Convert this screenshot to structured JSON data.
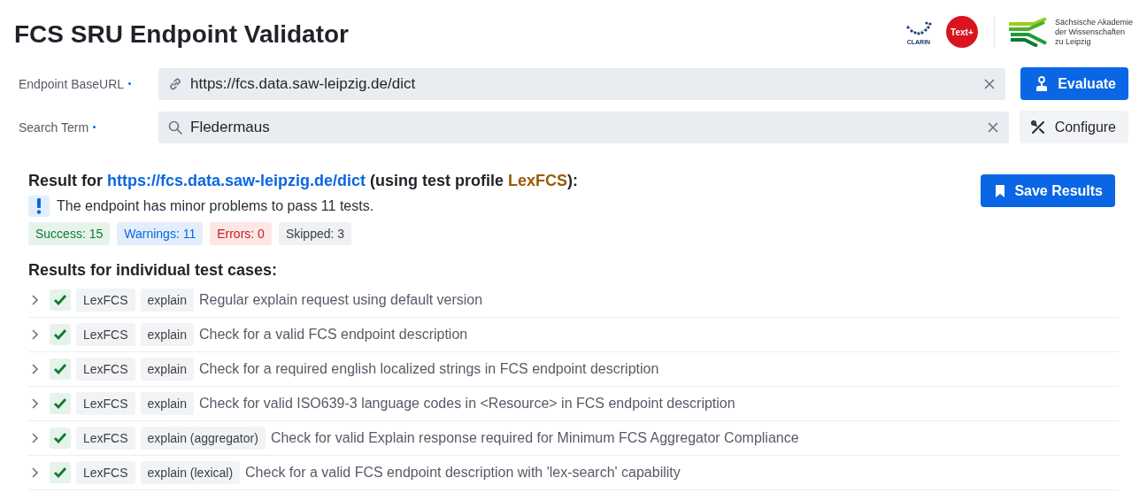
{
  "header": {
    "title": "FCS SRU Endpoint Validator",
    "logos": [
      {
        "kind": "clarin",
        "text": "CLARIN"
      },
      {
        "kind": "textplus",
        "text": "Text+"
      },
      {
        "kind": "saw",
        "lines": [
          "Sächsische Akademie",
          "der Wissenschaften",
          "zu Leipzig"
        ]
      }
    ]
  },
  "form": {
    "fields": [
      {
        "label": "Endpoint BaseURL",
        "required": true,
        "kind": "url",
        "value": "https://fcs.data.saw-leipzig.de/dict",
        "button": {
          "label": "Evaluate",
          "kind": "primary"
        }
      },
      {
        "label": "Search Term",
        "required": true,
        "kind": "search",
        "value": "Fledermaus",
        "button": {
          "label": "Configure",
          "kind": "secondary"
        }
      }
    ]
  },
  "result": {
    "prefix": "Result for",
    "endpoint": "https://fcs.data.saw-leipzig.de/dict",
    "middle": "(using test profile",
    "profile": "LexFCS",
    "suffix": "):",
    "message": "The endpoint has minor problems to pass 11 tests.",
    "save_button": "Save Results",
    "counts": [
      {
        "kind": "success",
        "label": "Success: 15"
      },
      {
        "kind": "warning",
        "label": "Warnings: 11"
      },
      {
        "kind": "error",
        "label": "Errors: 0"
      },
      {
        "kind": "skipped",
        "label": "Skipped: 3"
      }
    ]
  },
  "tests": {
    "heading": "Results for individual test cases:",
    "rows": [
      {
        "kind": "success",
        "expanded": false,
        "profile": "LexFCS",
        "category": "explain",
        "description": "Regular explain request using default version"
      },
      {
        "kind": "success",
        "expanded": false,
        "profile": "LexFCS",
        "category": "explain",
        "description": "Check for a valid FCS endpoint description"
      },
      {
        "kind": "success",
        "expanded": false,
        "profile": "LexFCS",
        "category": "explain",
        "description": "Check for a required english localized strings in FCS endpoint description"
      },
      {
        "kind": "success",
        "expanded": false,
        "profile": "LexFCS",
        "category": "explain",
        "description": "Check for valid ISO639-3 language codes in <Resource> in FCS endpoint description"
      },
      {
        "kind": "success",
        "expanded": false,
        "profile": "LexFCS",
        "category": "explain (aggregator)",
        "description": "Check for valid Explain response required for Minimum FCS Aggregator Compliance"
      },
      {
        "kind": "success",
        "expanded": false,
        "profile": "LexFCS",
        "category": "explain (lexical)",
        "description": "Check for a valid FCS endpoint description with 'lex-search' capability"
      }
    ]
  }
}
